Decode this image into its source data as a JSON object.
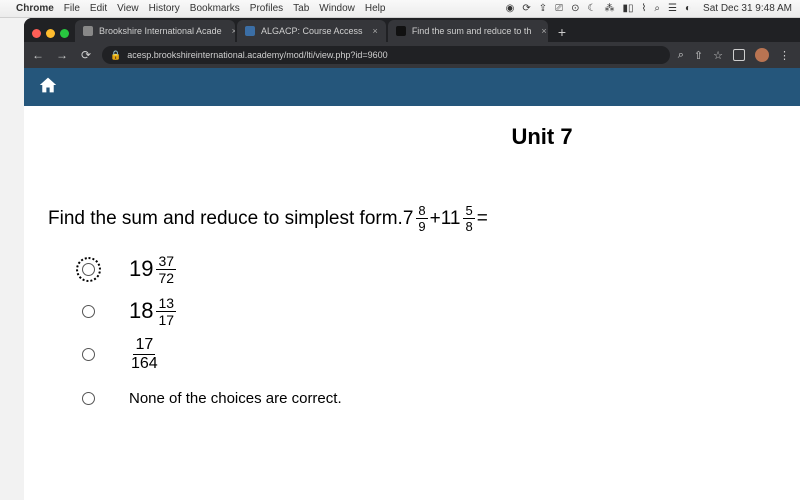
{
  "mac": {
    "app": "Chrome",
    "menus": [
      "File",
      "Edit",
      "View",
      "History",
      "Bookmarks",
      "Profiles",
      "Tab",
      "Window",
      "Help"
    ],
    "clock": "Sat Dec 31 9:48 AM"
  },
  "browser": {
    "tabs": [
      {
        "title": "Brookshire International Acade"
      },
      {
        "title": "ALGACP: Course Access"
      },
      {
        "title": "Find the sum and reduce to th"
      }
    ],
    "url": "acesp.brookshireinternational.academy/mod/lti/view.php?id=9600"
  },
  "page": {
    "unit": "Unit 7",
    "prompt_prefix": "Find the sum and reduce to simplest form. ",
    "expr": {
      "a_whole": "7",
      "a_num": "8",
      "a_den": "9",
      "plus": " + ",
      "b_whole": "11",
      "b_num": "5",
      "b_den": "8",
      "eq": " ="
    },
    "answers": {
      "a": {
        "whole": "19",
        "num": "37",
        "den": "72",
        "selected": true
      },
      "b": {
        "whole": "18",
        "num": "13",
        "den": "17",
        "selected": false
      },
      "c": {
        "num": "17",
        "den": "164",
        "selected": false
      },
      "d": {
        "text": "None of the choices are correct.",
        "selected": false
      }
    }
  }
}
